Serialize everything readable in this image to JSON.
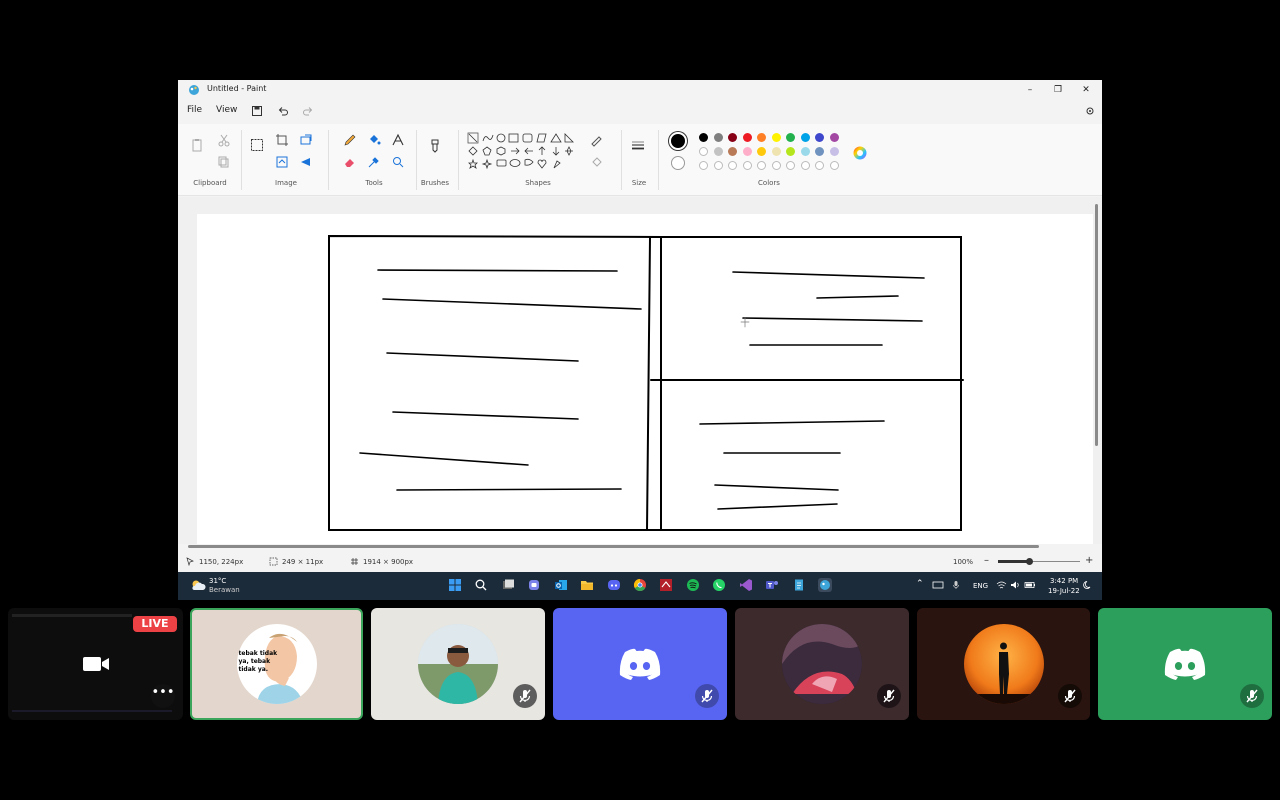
{
  "window": {
    "title": "Untitled - Paint",
    "menu": {
      "file": "File",
      "view": "View"
    }
  },
  "ribbon": {
    "groups": {
      "clipboard": "Clipboard",
      "image": "Image",
      "tools": "Tools",
      "brushes": "Brushes",
      "shapes": "Shapes",
      "size": "Size",
      "colors": "Colors"
    },
    "colors": {
      "row1": [
        "#000000",
        "#7f7f7f",
        "#880015",
        "#ed1c24",
        "#ff7f27",
        "#fff200",
        "#22b14c",
        "#00a2e8",
        "#3f48cc",
        "#a349a4"
      ],
      "row2": [
        "#ffffff",
        "#c3c3c3",
        "#b97a57",
        "#ffaec9",
        "#ffc90e",
        "#efe4b0",
        "#b5e61d",
        "#99d9ea",
        "#7092be",
        "#c8bfe7"
      ],
      "primary": "#000000",
      "secondary": "#ffffff"
    }
  },
  "status": {
    "cursor_pos": "1150, 224px",
    "selection_size": "249 × 11px",
    "canvas_size": "1914 × 900px",
    "zoom": "100%"
  },
  "taskbar": {
    "weather_temp": "31°C",
    "weather_desc": "Berawan",
    "language": "ENG",
    "time": "3:42 PM",
    "date": "19-Jul-22"
  },
  "call": {
    "live_label": "LIVE",
    "sticker_text": "tebak tidak ya, tebak tidak ya.",
    "more_label": "•••",
    "tile_colors": {
      "stream": "#0d0d0d",
      "tile1": "#e3d6cc",
      "tile2": "#e8e6e1",
      "tile3": "#5865f2",
      "tile4": "#3d2a2c",
      "tile5": "#2a1410",
      "tile6": "#2d9f5d"
    }
  }
}
